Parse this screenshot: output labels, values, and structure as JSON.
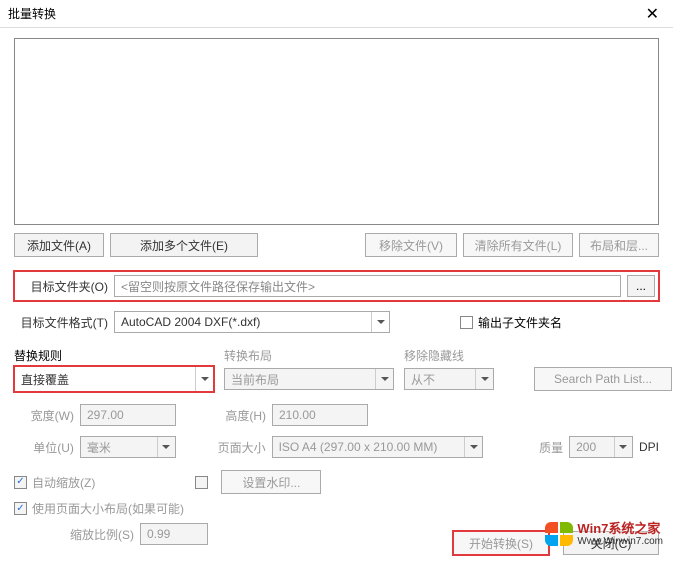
{
  "title": "批量转换",
  "buttons": {
    "add_file": "添加文件(A)",
    "add_multi": "添加多个文件(E)",
    "remove_file": "移除文件(V)",
    "clear_all": "清除所有文件(L)",
    "layout_layer": "布局和层...",
    "browse": "...",
    "set_watermark": "设置水印...",
    "search_path": "Search Path List...",
    "start": "开始转换(S)",
    "close": "关闭(C)"
  },
  "labels": {
    "target_folder": "目标文件夹(O)",
    "target_format": "目标文件格式(T)",
    "output_subfolder": "输出子文件夹名",
    "replace_rule": "替换规则",
    "convert_layout": "转换布局",
    "remove_hidden": "移除隐藏线",
    "width": "宽度(W)",
    "height": "高度(H)",
    "unit": "单位(U)",
    "page_size": "页面大小",
    "quality": "质量",
    "dpi": "DPI",
    "auto_scale": "自动缩放(Z)",
    "use_page_layout": "使用页面大小布局(如果可能)",
    "scale_ratio": "缩放比例(S)"
  },
  "values": {
    "target_folder_placeholder": "<留空则按原文件路径保存输出文件>",
    "target_format": "AutoCAD 2004 DXF(*.dxf)",
    "replace_rule": "直接覆盖",
    "convert_layout": "当前布局",
    "remove_hidden": "从不",
    "width": "297.00",
    "height": "210.00",
    "unit": "毫米",
    "page_size": "ISO A4 (297.00 x 210.00 MM)",
    "quality": "200",
    "scale_ratio": "0.99",
    "output_subfolder_checked": false,
    "auto_scale_checked": true,
    "use_page_layout_checked": true
  },
  "watermark": {
    "line1": "Win7系统之家",
    "line2": "Www.Winwin7.com"
  }
}
